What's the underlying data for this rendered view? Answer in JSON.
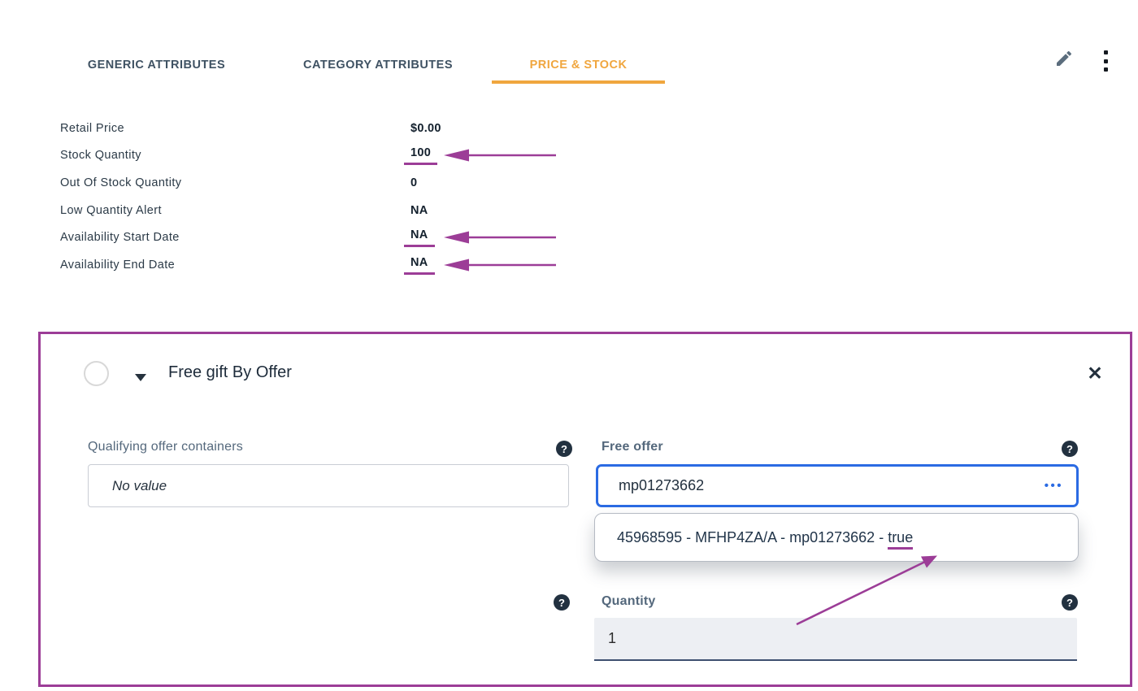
{
  "tabs": {
    "items": [
      {
        "label": "GENERIC ATTRIBUTES"
      },
      {
        "label": "CATEGORY ATTRIBUTES"
      },
      {
        "label": "PRICE & STOCK"
      }
    ],
    "active_index": 2
  },
  "toolbar": {
    "edit_icon": "pencil-icon",
    "menu_icon": "kebab-menu-icon"
  },
  "attributes": {
    "rows": [
      {
        "label": "Retail Price",
        "value": "$0.00"
      },
      {
        "label": "Stock Quantity",
        "value": "100"
      },
      {
        "label": "Out Of Stock Quantity",
        "value": "0"
      },
      {
        "label": "Low Quantity Alert",
        "value": "NA"
      },
      {
        "label": "Availability Start Date",
        "value": "NA"
      },
      {
        "label": "Availability End Date",
        "value": "NA"
      }
    ]
  },
  "panel": {
    "title": "Free gift By Offer",
    "close_glyph": "✕",
    "help_glyph": "?",
    "fields": {
      "qualifying": {
        "label": "Qualifying offer containers",
        "placeholder": "No value"
      },
      "free_offer": {
        "label": "Free offer",
        "value": "mp01273662",
        "ellipsis_glyph": "•••"
      },
      "suggestion": {
        "prefix": "45968595 - MFHP4ZA/A - mp01273662 - ",
        "highlight": "true"
      },
      "quantity": {
        "label": "Quantity",
        "value": "1"
      }
    }
  },
  "colors": {
    "annotation_purple": "#9C3D97",
    "active_tab_orange": "#F0A63E",
    "focus_blue": "#2B6BE3",
    "help_navy": "#223140",
    "label_slate": "#54687C"
  }
}
